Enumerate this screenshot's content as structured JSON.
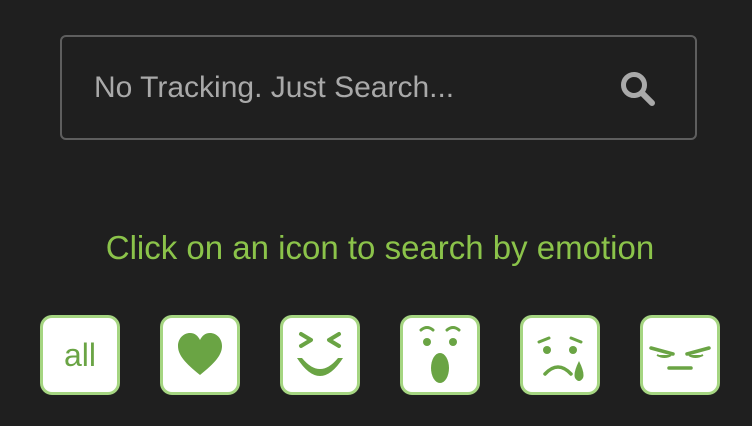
{
  "search": {
    "placeholder": "No Tracking. Just Search...",
    "value": "",
    "icon": "search-icon"
  },
  "headline": "Click on an icon to search by emotion",
  "colors": {
    "background": "#1f1f1f",
    "accent": "#8bc34a",
    "icon_green": "#6aa444",
    "tile_border": "#a5d581",
    "search_border": "#5e5e5e",
    "placeholder": "#a9a9a9"
  },
  "emotions": [
    {
      "label": "all",
      "icon": "all-icon"
    },
    {
      "icon": "heart-icon"
    },
    {
      "icon": "laughing-face-icon"
    },
    {
      "icon": "surprised-face-icon"
    },
    {
      "icon": "crying-face-icon"
    },
    {
      "icon": "angry-face-icon"
    }
  ]
}
